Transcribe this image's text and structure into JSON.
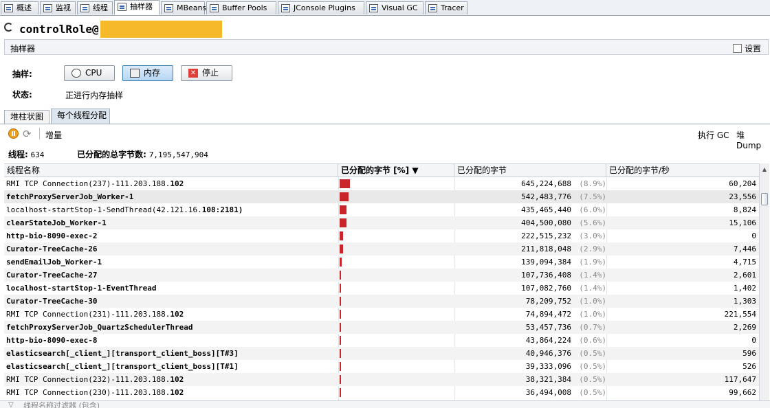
{
  "tabs": [
    {
      "label": "概述",
      "icon": "overview-icon"
    },
    {
      "label": "监视",
      "icon": "monitor-icon"
    },
    {
      "label": "线程",
      "icon": "threads-icon"
    },
    {
      "label": "抽样器",
      "icon": "sampler-icon",
      "selected": true
    },
    {
      "label": "MBeans",
      "icon": "mbeans-icon"
    },
    {
      "label": "Buffer Pools",
      "icon": "buffer-pools-icon"
    },
    {
      "label": "JConsole Plugins",
      "icon": "jconsole-plugins-icon"
    },
    {
      "label": "Visual GC",
      "icon": "visual-gc-icon"
    },
    {
      "label": "Tracer",
      "icon": "tracer-icon"
    }
  ],
  "header": {
    "title": "controlRole@"
  },
  "sampler_panel": {
    "title": "抽样器",
    "settings_label": "设置"
  },
  "sampling": {
    "label": "抽样:",
    "buttons": {
      "cpu": "CPU",
      "memory": "内存",
      "stop": "停止"
    },
    "status_label": "状态:",
    "status_value": "正进行内存抽样"
  },
  "view_tabs": {
    "heap": "堆柱状图",
    "per_thread": "每个线程分配"
  },
  "toolbar": {
    "delta": "增量",
    "gc": "执行 GC",
    "heap_dump": "堆 Dump"
  },
  "summary": {
    "threads_label": "线程:",
    "threads_value": "634",
    "total_label": "已分配的总字节数:",
    "total_value": "7,195,547,904"
  },
  "table": {
    "columns": {
      "name": "线程名称",
      "alloc_bar": "已分配的字节 [%] ▼",
      "alloc": "已分配的字节",
      "rate": "已分配的字节/秒"
    },
    "rows": [
      {
        "name": "RMI TCP Connection(237)-111.203.188.",
        "suffix": "102",
        "bytes": "645,224,688",
        "pct": "(8.9%)",
        "rate": "60,204",
        "share": 8.9
      },
      {
        "name": "fetchProxyServerJob_Worker-1",
        "suffix": "",
        "bytes": "542,483,776",
        "pct": "(7.5%)",
        "rate": "23,556",
        "share": 7.5,
        "bold": true
      },
      {
        "name": "localhost-startStop-1-SendThread(42.121.16.",
        "suffix": "108:2181)",
        "bytes": "435,465,440",
        "pct": "(6.0%)",
        "rate": "8,824",
        "share": 6.0
      },
      {
        "name": "clearStateJob_Worker-1",
        "suffix": "",
        "bytes": "404,500,080",
        "pct": "(5.6%)",
        "rate": "15,106",
        "share": 5.6,
        "bold": true
      },
      {
        "name": "http-bio-8090-exec-2",
        "suffix": "",
        "bytes": "222,515,232",
        "pct": "(3.0%)",
        "rate": "0",
        "share": 3.0,
        "bold": true
      },
      {
        "name": "Curator-TreeCache-26",
        "suffix": "",
        "bytes": "211,818,048",
        "pct": "(2.9%)",
        "rate": "7,446",
        "share": 2.9,
        "bold": true
      },
      {
        "name": "sendEmailJob_Worker-1",
        "suffix": "",
        "bytes": "139,094,384",
        "pct": "(1.9%)",
        "rate": "4,715",
        "share": 1.9,
        "bold": true
      },
      {
        "name": "Curator-TreeCache-27",
        "suffix": "",
        "bytes": "107,736,408",
        "pct": "(1.4%)",
        "rate": "2,601",
        "share": 1.4,
        "bold": true
      },
      {
        "name": "localhost-startStop-1-EventThread",
        "suffix": "",
        "bytes": "107,082,760",
        "pct": "(1.4%)",
        "rate": "1,402",
        "share": 1.4,
        "bold": true
      },
      {
        "name": "Curator-TreeCache-30",
        "suffix": "",
        "bytes": "78,209,752",
        "pct": "(1.0%)",
        "rate": "1,303",
        "share": 1.0,
        "bold": true
      },
      {
        "name": "RMI TCP Connection(231)-111.203.188.",
        "suffix": "102",
        "bytes": "74,894,472",
        "pct": "(1.0%)",
        "rate": "221,554",
        "share": 1.0
      },
      {
        "name": "fetchProxyServerJob_QuartzSchedulerThread",
        "suffix": "",
        "bytes": "53,457,736",
        "pct": "(0.7%)",
        "rate": "2,269",
        "share": 0.7,
        "bold": true
      },
      {
        "name": "http-bio-8090-exec-8",
        "suffix": "",
        "bytes": "43,864,224",
        "pct": "(0.6%)",
        "rate": "0",
        "share": 0.6,
        "bold": true
      },
      {
        "name": "elasticsearch[_client_][transport_client_boss][T#3]",
        "suffix": "",
        "bytes": "40,946,376",
        "pct": "(0.5%)",
        "rate": "596",
        "share": 0.5,
        "bold": true
      },
      {
        "name": "elasticsearch[_client_][transport_client_boss][T#1]",
        "suffix": "",
        "bytes": "39,333,096",
        "pct": "(0.5%)",
        "rate": "526",
        "share": 0.5,
        "bold": true
      },
      {
        "name": "RMI TCP Connection(232)-111.203.188.",
        "suffix": "102",
        "bytes": "38,321,384",
        "pct": "(0.5%)",
        "rate": "117,647",
        "share": 0.5
      },
      {
        "name": "RMI TCP Connection(230)-111.203.188.",
        "suffix": "102",
        "bytes": "36,494,008",
        "pct": "(0.5%)",
        "rate": "99,662",
        "share": 0.5
      }
    ]
  },
  "filter": {
    "placeholder": "线程名称过滤器 (包含)"
  },
  "colors": {
    "bar": "#c8262b",
    "redaction": "#f5b92a",
    "accent": "#3c7fb1"
  }
}
